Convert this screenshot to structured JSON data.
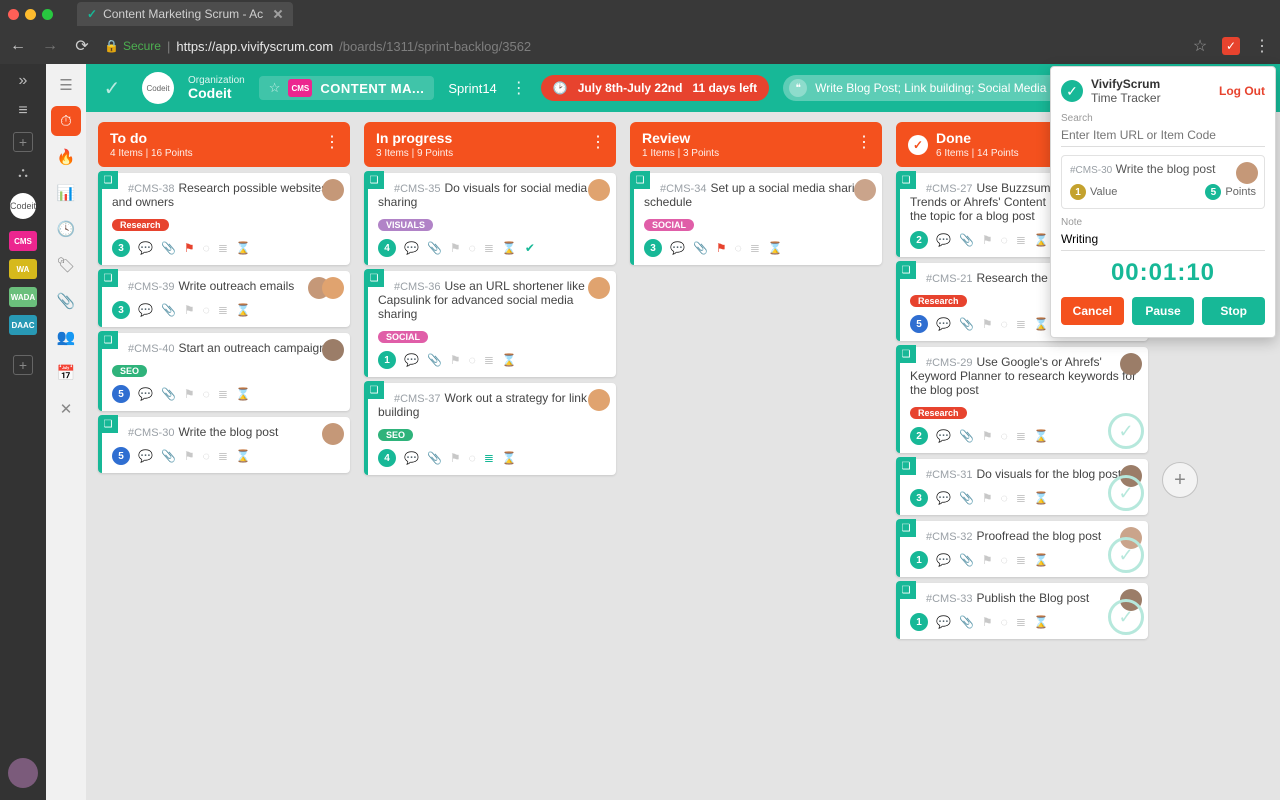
{
  "browser": {
    "tab_title": "Content Marketing Scrum - Ac",
    "secure_label": "Secure",
    "url_host": "https://app.vivifyscrum.com",
    "url_path": "/boards/1311/sprint-backlog/3562"
  },
  "mini_nav": {
    "badges": [
      {
        "text": "CMS",
        "cls": "badge-cms"
      },
      {
        "text": "WA",
        "cls": "badge-wa"
      },
      {
        "text": "WADA",
        "cls": "badge-wada"
      },
      {
        "text": "DAAC",
        "cls": "badge-daac"
      }
    ]
  },
  "header": {
    "org_label": "Organization",
    "org_name": "Codeit",
    "board_badge": "CMS",
    "board_name": "CONTENT MA...",
    "sprint_name": "Sprint14",
    "sprint_date": "July 8th-July 22nd",
    "sprint_remaining": "11 days left",
    "sprint_goal": "Write Blog Post; Link building; Social Media"
  },
  "columns": [
    {
      "title": "To do",
      "subtitle": "4 Items | 16 Points",
      "done": false,
      "cards": [
        {
          "code": "#CMS-38",
          "title": "Research possible websites and owners",
          "tag": {
            "text": "Research",
            "cls": "red"
          },
          "points": 3,
          "points_cls": "teal",
          "flag": true,
          "avatar": "a1"
        },
        {
          "code": "#CMS-39",
          "title": "Write outreach emails",
          "points": 3,
          "points_cls": "teal",
          "double": true
        },
        {
          "code": "#CMS-40",
          "title": "Start an outreach campaign",
          "tag": {
            "text": "SEO",
            "cls": "green"
          },
          "points": 5,
          "points_cls": "blue",
          "avatar": "a3"
        },
        {
          "code": "#CMS-30",
          "title": "Write the blog post",
          "points": 5,
          "points_cls": "blue",
          "avatar": "a1"
        }
      ]
    },
    {
      "title": "In progress",
      "subtitle": "3 Items | 9 Points",
      "done": false,
      "cards": [
        {
          "code": "#CMS-35",
          "title": "Do visuals for social media sharing",
          "tag": {
            "text": "VISUALS",
            "cls": "violet"
          },
          "points": 4,
          "points_cls": "teal",
          "hourglass": true,
          "check_teal": true,
          "avatar": "a2"
        },
        {
          "code": "#CMS-36",
          "title": "Use an URL shortener like Capsulink for advanced social media sharing",
          "tag": {
            "text": "SOCIAL",
            "cls": "pink"
          },
          "points": 1,
          "points_cls": "teal",
          "avatar": "a2"
        },
        {
          "code": "#CMS-37",
          "title": "Work out a strategy for link building",
          "tag": {
            "text": "SEO",
            "cls": "green"
          },
          "points": 4,
          "points_cls": "teal",
          "list_teal": true,
          "avatar": "a2"
        }
      ]
    },
    {
      "title": "Review",
      "subtitle": "1 Items | 3 Points",
      "done": false,
      "cards": [
        {
          "code": "#CMS-34",
          "title": "Set up a social media sharing schedule",
          "tag": {
            "text": "SOCIAL",
            "cls": "pink"
          },
          "points": 3,
          "points_cls": "teal",
          "flag": true,
          "avatar": "a4"
        }
      ]
    },
    {
      "title": "Done",
      "subtitle": "6 Items | 14 Points",
      "done": true,
      "cards": [
        {
          "code": "#CMS-27",
          "title": "Use Buzzsumo, Google Trends or Ahrefs' Content Explorer to find the topic for a blog post",
          "points": 2,
          "points_cls": "teal",
          "attach": true,
          "big_check": true,
          "avatar": "a3"
        },
        {
          "code": "#CMS-21",
          "title": "Research the topic",
          "tag": {
            "text": "Research",
            "cls": "red"
          },
          "points": 5,
          "points_cls": "blue",
          "attach": true,
          "big_check": true
        },
        {
          "code": "#CMS-29",
          "title": "Use Google's or Ahrefs' Keyword Planner to research keywords for the blog post",
          "tag": {
            "text": "Research",
            "cls": "red"
          },
          "points": 2,
          "points_cls": "teal",
          "comment": true,
          "big_check": true,
          "avatar": "a3"
        },
        {
          "code": "#CMS-31",
          "title": "Do visuals for the blog post",
          "points": 3,
          "points_cls": "teal",
          "big_check": true,
          "avatar": "a3"
        },
        {
          "code": "#CMS-32",
          "title": "Proofread the blog post",
          "points": 1,
          "points_cls": "teal",
          "big_check": true,
          "avatar": "a4"
        },
        {
          "code": "#CMS-33",
          "title": "Publish the Blog post",
          "points": 1,
          "points_cls": "teal",
          "big_check": true,
          "avatar": "a3"
        }
      ]
    }
  ],
  "tracker": {
    "brand_line1": "VivifyScrum",
    "brand_line2": "Time Tracker",
    "logout": "Log Out",
    "search_label": "Search",
    "search_placeholder": "Enter Item URL or Item Code",
    "item_code": "#CMS-30",
    "item_title": "Write the blog post",
    "value_label": "Value",
    "value_n": "1",
    "points_label": "Points",
    "points_n": "5",
    "note_label": "Note",
    "note_value": "Writing",
    "timer": "00:01:10",
    "cancel": "Cancel",
    "pause": "Pause",
    "stop": "Stop"
  }
}
